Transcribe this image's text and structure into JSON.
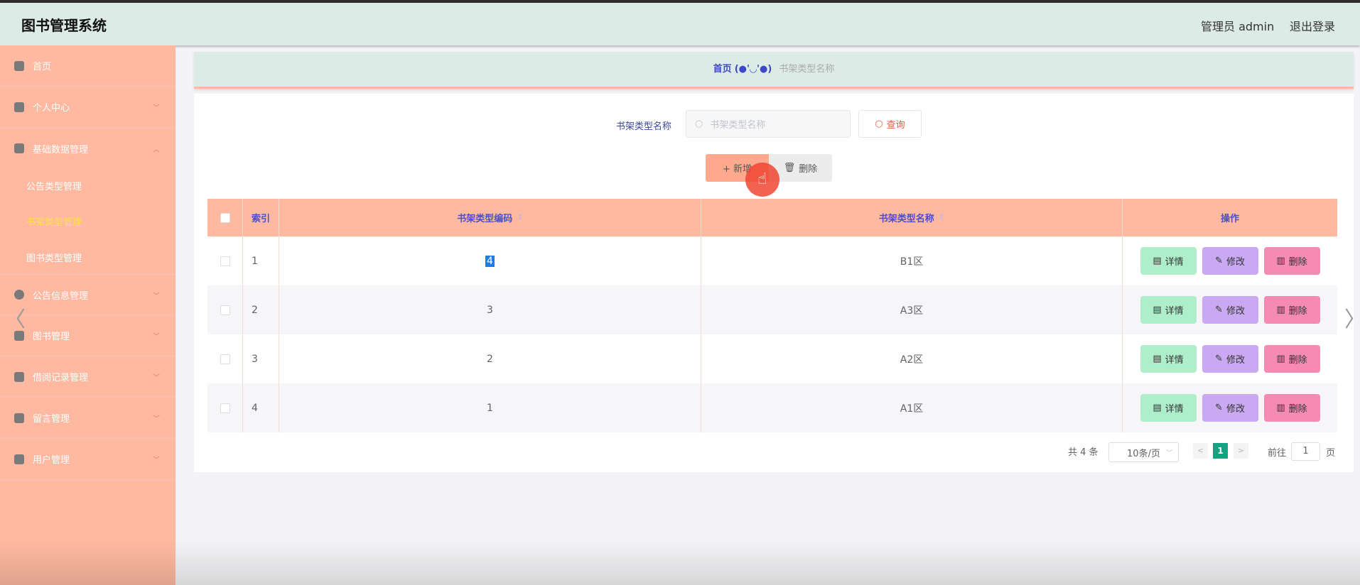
{
  "header": {
    "title": "图书管理系统",
    "user": "管理员 admin",
    "logout": "退出登录"
  },
  "sidebar": {
    "items": [
      {
        "label": "首页",
        "icon": "home-icon"
      },
      {
        "label": "个人中心",
        "icon": "user-icon"
      },
      {
        "label": "基础数据管理",
        "icon": "briefcase-icon",
        "expanded": true,
        "children": [
          {
            "label": "公告类型管理"
          },
          {
            "label": "书架类型管理",
            "active": true
          },
          {
            "label": "图书类型管理"
          }
        ]
      },
      {
        "label": "公告信息管理",
        "icon": "bulb-icon"
      },
      {
        "label": "图书管理",
        "icon": "chat-icon"
      },
      {
        "label": "借阅记录管理",
        "icon": "grid-icon"
      },
      {
        "label": "留言管理",
        "icon": "table-icon"
      },
      {
        "label": "用户管理",
        "icon": "calendar-icon"
      }
    ]
  },
  "breadcrumb": {
    "home": "首页",
    "face": "(●'◡'●)",
    "current": "书架类型名称"
  },
  "search": {
    "label": "书架类型名称",
    "placeholder": "书架类型名称",
    "value": "",
    "button": "查询"
  },
  "toolbar": {
    "add": "+ 新增",
    "delete": "删除"
  },
  "table": {
    "columns": [
      "索引",
      "书架类型编码",
      "书架类型名称",
      "操作"
    ],
    "rows": [
      {
        "index": "1",
        "code": "4",
        "name": "B1区"
      },
      {
        "index": "2",
        "code": "3",
        "name": "A3区"
      },
      {
        "index": "3",
        "code": "2",
        "name": "A2区"
      },
      {
        "index": "4",
        "code": "1",
        "name": "A1区"
      }
    ],
    "actions": {
      "detail": "详情",
      "edit": "修改",
      "delete": "删除"
    }
  },
  "pagination": {
    "total": "共 4 条",
    "page_size": "10条/页",
    "current": "1",
    "goto_label": "前往",
    "goto_value": "1",
    "goto_unit": "页"
  },
  "colors": {
    "sidebar": "#ffb9a1",
    "header": "#dcebe6",
    "accent": "#13a383"
  }
}
